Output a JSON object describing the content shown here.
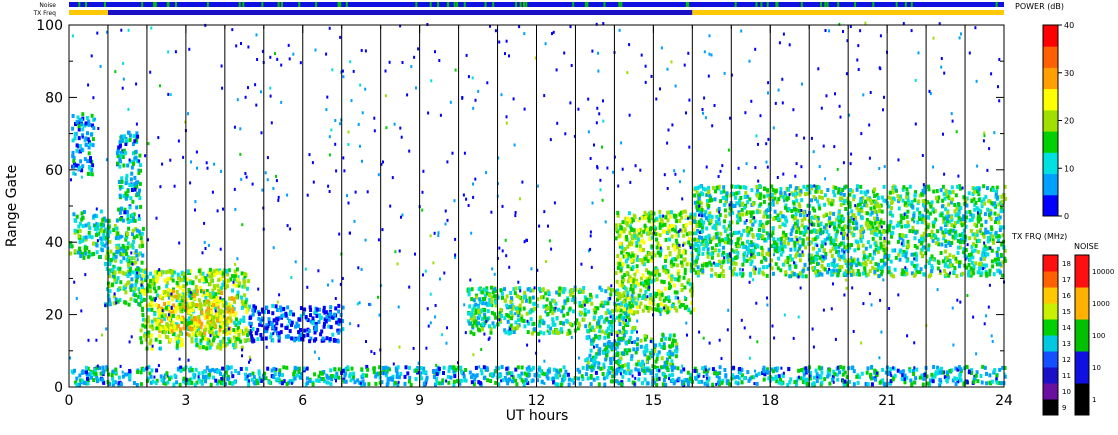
{
  "chart_data": {
    "type": "heatmap",
    "xlabel": "UT hours",
    "ylabel": "Range Gate",
    "xlim": [
      0,
      24
    ],
    "ylim": [
      0,
      100
    ],
    "x_ticks": [
      0,
      3,
      6,
      9,
      12,
      15,
      18,
      21,
      24
    ],
    "y_ticks": [
      0,
      20,
      40,
      60,
      80,
      100
    ],
    "grid": "vertical lines at each hour",
    "noise_label": "Noise",
    "txfreq_label": "TX Freq",
    "colorbars": {
      "power": {
        "title": "POWER (dB)",
        "range": [
          0,
          40
        ],
        "ticks": [
          0,
          10,
          20,
          30,
          40
        ],
        "colors": [
          "#0000ff",
          "#00a0ff",
          "#00e0e0",
          "#00d000",
          "#a0e000",
          "#ffff00",
          "#ffa000",
          "#ff6000",
          "#ff0000"
        ]
      },
      "tx_freq": {
        "title": "TX FRQ (MHz)",
        "ticks": [
          9,
          10,
          11,
          12,
          13,
          14,
          15,
          16,
          17,
          18
        ],
        "colors": [
          "#000000",
          "#6a0fa0",
          "#1a10c8",
          "#1450ff",
          "#00c8e0",
          "#00d000",
          "#c8f000",
          "#ffc800",
          "#ff6000",
          "#ff1010"
        ]
      },
      "noise": {
        "title": "NOISE",
        "ticks": [
          1,
          10,
          100,
          1000,
          10000
        ],
        "colors": [
          "#000000",
          "#1010e0",
          "#00c000",
          "#ffb000",
          "#ff1010"
        ]
      }
    },
    "echo_regions": [
      {
        "x0": 0.0,
        "x1": 1.0,
        "y0": 35,
        "y1": 48,
        "power": 12
      },
      {
        "x0": 0.05,
        "x1": 0.6,
        "y0": 58,
        "y1": 75,
        "power": 8
      },
      {
        "x0": 0.9,
        "x1": 1.9,
        "y0": 22,
        "y1": 44,
        "power": 14
      },
      {
        "x0": 1.2,
        "x1": 1.8,
        "y0": 45,
        "y1": 70,
        "power": 10
      },
      {
        "x0": 1.8,
        "x1": 4.6,
        "y0": 10,
        "y1": 32,
        "power": 18
      },
      {
        "x0": 2.2,
        "x1": 4.2,
        "y0": 14,
        "y1": 26,
        "power": 24
      },
      {
        "x0": 4.6,
        "x1": 7.0,
        "y0": 12,
        "y1": 22,
        "power": 4
      },
      {
        "x0": 10.2,
        "x1": 14.5,
        "y0": 14,
        "y1": 27,
        "power": 14
      },
      {
        "x0": 13.2,
        "x1": 15.6,
        "y0": 4,
        "y1": 14,
        "power": 12
      },
      {
        "x0": 14.0,
        "x1": 16.0,
        "y0": 20,
        "y1": 48,
        "power": 18
      },
      {
        "x0": 16.0,
        "x1": 24.0,
        "y0": 30,
        "y1": 55,
        "power": 14
      },
      {
        "x0": 0.0,
        "x1": 24.0,
        "y0": 0,
        "y1": 5,
        "power": 10
      }
    ]
  }
}
